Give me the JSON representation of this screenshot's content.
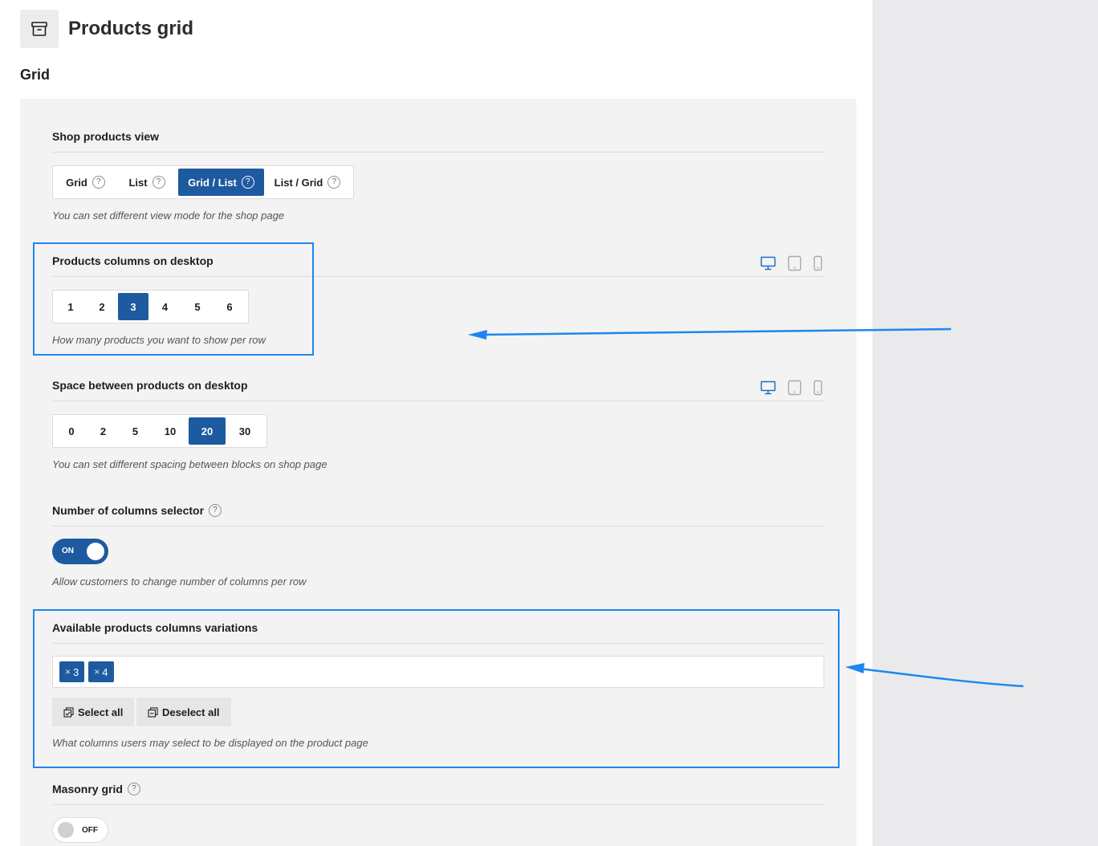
{
  "page": {
    "title": "Products grid"
  },
  "section": {
    "title": "Grid"
  },
  "shop_view": {
    "label": "Shop products view",
    "options": [
      {
        "label": "Grid",
        "help": "?"
      },
      {
        "label": "List",
        "help": "?"
      },
      {
        "label": "Grid / List",
        "help": "?"
      },
      {
        "label": "List / Grid",
        "help": "?"
      }
    ],
    "selected": "Grid / List",
    "description": "You can set different view mode for the shop page"
  },
  "columns_desktop": {
    "label": "Products columns on desktop",
    "options": [
      "1",
      "2",
      "3",
      "4",
      "5",
      "6"
    ],
    "selected": "3",
    "description": "How many products you want to show per row"
  },
  "space_desktop": {
    "label": "Space between products on desktop",
    "options": [
      "0",
      "2",
      "5",
      "10",
      "20",
      "30"
    ],
    "selected": "20",
    "description": "You can set different spacing between blocks on shop page"
  },
  "columns_selector": {
    "label": "Number of columns selector",
    "help": "?",
    "toggle_label": "ON",
    "enabled": true,
    "description": "Allow customers to change number of columns per row"
  },
  "columns_variations": {
    "label": "Available products columns variations",
    "tags": [
      {
        "remove": "×",
        "value": "3"
      },
      {
        "remove": "×",
        "value": "4"
      }
    ],
    "select_all_label": "Select all",
    "deselect_all_label": "Deselect all",
    "description": "What columns users may select to be displayed on the product page"
  },
  "masonry": {
    "label": "Masonry grid",
    "help": "?",
    "toggle_label": "OFF",
    "enabled": false
  },
  "icons": {
    "header": "archive-box-icon",
    "devices": [
      "desktop-icon",
      "tablet-icon",
      "mobile-icon"
    ]
  },
  "colors": {
    "accent": "#1e5aa0",
    "annotation": "#1e86f0",
    "panel_bg": "#f3f3f3",
    "side_bg": "#eaeaec"
  }
}
